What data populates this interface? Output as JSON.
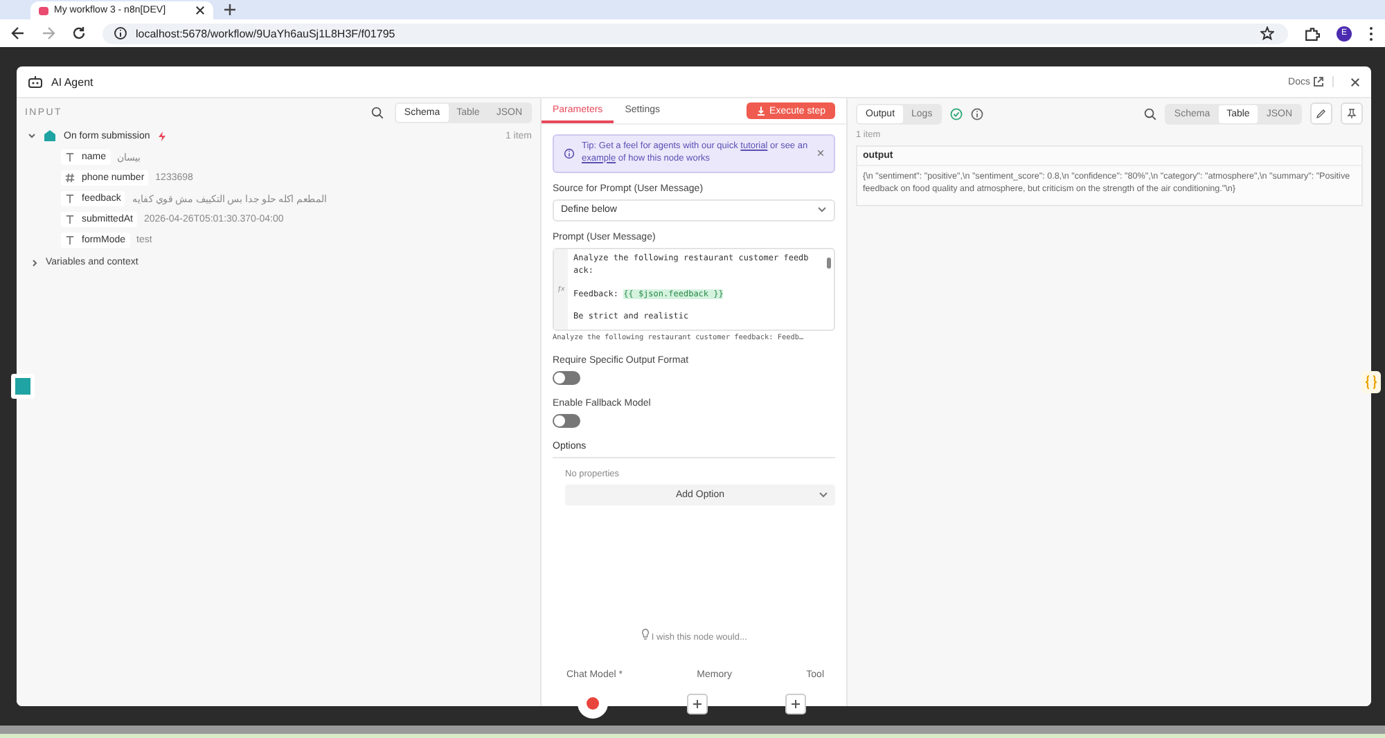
{
  "browser": {
    "tab_title": "My workflow 3 - n8n[DEV]",
    "url": "localhost:5678/workflow/9UaYh6auSj1L8H3F/f01795",
    "profile": "E"
  },
  "panel": {
    "title": "AI Agent",
    "docs": "Docs"
  },
  "input": {
    "heading": "INPUT",
    "views": [
      {
        "label": "Schema",
        "selected": true
      },
      {
        "label": "Table",
        "selected": false
      },
      {
        "label": "JSON",
        "selected": false
      }
    ],
    "node": {
      "name": "On form submission",
      "count": "1 item",
      "expanded": true
    },
    "fields": [
      {
        "kind": "text",
        "name": "name",
        "value": "بيسان"
      },
      {
        "kind": "number",
        "name": "phone number",
        "value": "1233698"
      },
      {
        "kind": "text",
        "name": "feedback",
        "value": "المطعم اكله حلو جدا بس التكييف مش قوي كفايه"
      },
      {
        "kind": "text",
        "name": "submittedAt",
        "value": "2026-04-26T05:01:30.370-04:00"
      },
      {
        "kind": "text",
        "name": "formMode",
        "value": "test"
      }
    ],
    "variables": {
      "label": "Variables and context",
      "expanded": false
    }
  },
  "params": {
    "tabs": [
      {
        "label": "Parameters",
        "selected": true
      },
      {
        "label": "Settings",
        "selected": false
      }
    ],
    "execute": "Execute step",
    "tip": [
      {
        "kind": "text",
        "text": "Tip: Get a feel for agents with our quick "
      },
      {
        "kind": "link",
        "text": "tutorial"
      },
      {
        "kind": "text",
        "text": " or see an "
      },
      {
        "kind": "link",
        "text": "example"
      },
      {
        "kind": "text",
        "text": " of how this node works"
      }
    ],
    "source_label": "Source for Prompt (User Message)",
    "source_value": "Define below",
    "prompt_label": "Prompt (User Message)",
    "expression_marker": "ƒx",
    "prompt_lines": [
      {
        "text": "Analyze the following restaurant customer feedb",
        "gap_before": false
      },
      {
        "text": "ack:",
        "gap_before": false
      },
      {
        "text": "Feedback: ",
        "expression": "{{ $json.feedback }}",
        "gap_before": true
      },
      {
        "text": "Be strict and realistic",
        "gap_before": true
      }
    ],
    "prompt_hint": "Analyze the following restaurant customer feedback: Feedb…",
    "toggles": [
      {
        "label": "Require Specific Output Format",
        "on": false
      },
      {
        "label": "Enable Fallback Model",
        "on": false
      }
    ],
    "options_heading": "Options",
    "no_properties": "No properties",
    "add_option": "Add Option",
    "wish": "I wish this node would...",
    "connectors": [
      {
        "label": "Chat Model *",
        "connected": true
      },
      {
        "label": "Memory",
        "connected": false
      },
      {
        "label": "Tool",
        "connected": false
      }
    ]
  },
  "output": {
    "tabs": [
      {
        "label": "Output",
        "selected": true
      },
      {
        "label": "Logs",
        "selected": false
      }
    ],
    "count": "1 item",
    "views": [
      {
        "label": "Schema",
        "selected": false
      },
      {
        "label": "Table",
        "selected": true
      },
      {
        "label": "JSON",
        "selected": false
      }
    ],
    "column": "output",
    "value": "{\\n  \"sentiment\": \"positive\",\\n  \"sentiment_score\": 0.8,\\n  \"confidence\": \"80%\",\\n  \"category\": \"atmosphere\",\\n  \"summary\": \"Positive feedback on food quality and atmosphere, but criticism on the strength of the air conditioning.\"\\n}"
  }
}
